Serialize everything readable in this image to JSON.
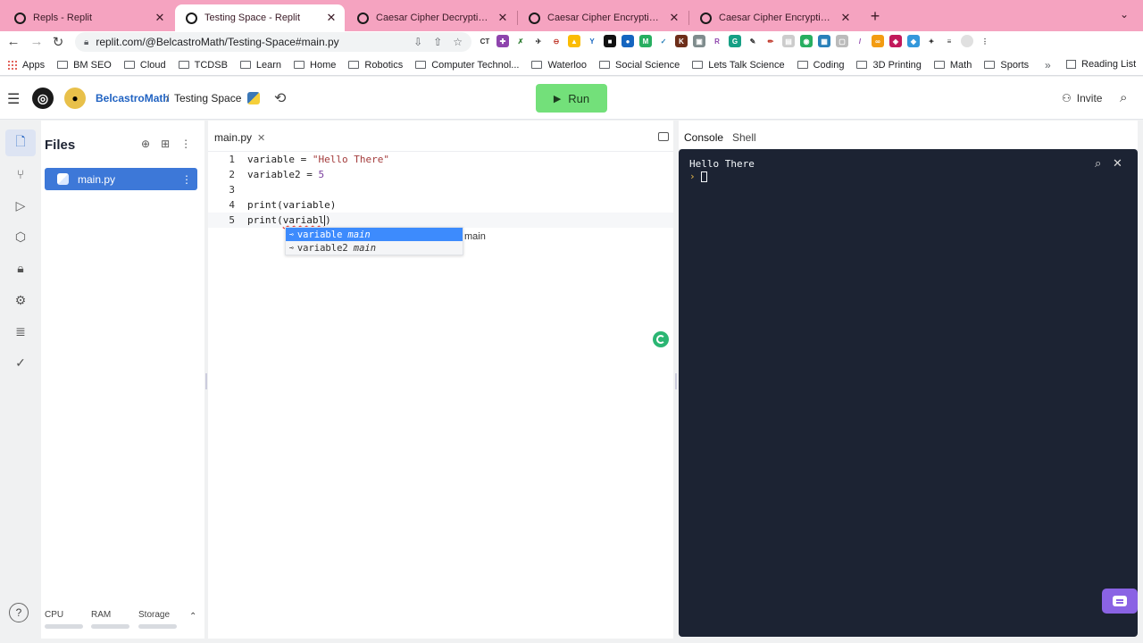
{
  "browser": {
    "tabs": [
      {
        "title": "Repls - Replit"
      },
      {
        "title": "Testing Space - Replit"
      },
      {
        "title": "Caesar Cipher Decryption - Re"
      },
      {
        "title": "Caesar Cipher Encryption and"
      },
      {
        "title": "Caesar Cipher Encryption and"
      }
    ],
    "url": "replit.com/@BelcastroMath/Testing-Space#main.py",
    "bookmarks": [
      "Apps",
      "BM SEO",
      "Cloud",
      "TCDSB",
      "Learn",
      "Home",
      "Robotics",
      "Computer Technol...",
      "Waterloo",
      "Social Science",
      "Lets Talk Science",
      "Coding",
      "3D Printing",
      "Math",
      "Sports"
    ],
    "reading_list": "Reading List",
    "more_label": "»"
  },
  "header": {
    "username": "BelcastroMath",
    "separator": "/",
    "repl_name": "Testing Space",
    "run_label": "Run",
    "invite_label": "Invite"
  },
  "files": {
    "title": "Files",
    "items": [
      {
        "name": "main.py"
      }
    ],
    "resources": [
      "CPU",
      "RAM",
      "Storage"
    ]
  },
  "editor": {
    "tab": "main.py",
    "lines": [
      {
        "n": "1"
      },
      {
        "n": "2"
      },
      {
        "n": "3"
      },
      {
        "n": "4"
      },
      {
        "n": "5"
      }
    ],
    "code": {
      "l1_a": "variable = ",
      "l1_b": "\"Hello There\"",
      "l2_a": "variable2 = ",
      "l2_b": "5",
      "l4": "print(variable)",
      "l5_a": "print(",
      "l5_b": "variabl",
      "l5_c": ")"
    },
    "autocomplete": [
      {
        "match": "variabl",
        "rest": "e",
        "module": "main"
      },
      {
        "match": "variabl",
        "rest": "e2",
        "module": "main"
      }
    ],
    "autocomplete_detail": "main"
  },
  "console": {
    "tabs": [
      "Console",
      "Shell"
    ],
    "output": "Hello There",
    "prompt": "›"
  },
  "colors": {
    "tabstrip": "#f5a3c0",
    "run_button": "#73e07a",
    "selection": "#3d78d8",
    "console_bg": "#1c2333"
  }
}
